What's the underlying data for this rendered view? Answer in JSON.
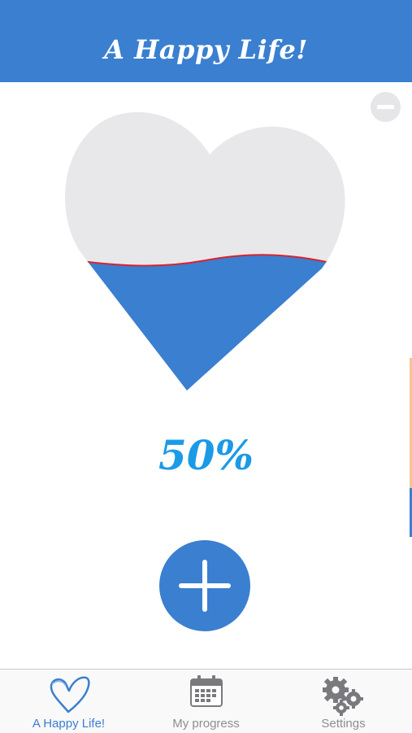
{
  "header": {
    "title": "A Happy Life!"
  },
  "heart": {
    "fill_level": 0.5
  },
  "progress": {
    "percent_label": "50%"
  },
  "tabs": [
    {
      "label": "A Happy Life!",
      "icon": "heart-outline-icon",
      "active": true
    },
    {
      "label": "My progress",
      "icon": "calendar-icon",
      "active": false
    },
    {
      "label": "Settings",
      "icon": "gears-icon",
      "active": false
    }
  ],
  "colors": {
    "primary": "#3a7fd0",
    "heart_empty": "#e8e8ea",
    "wave_line": "#d9232e",
    "percent_text": "#1b9ae6",
    "tab_inactive": "#8e8e93"
  }
}
